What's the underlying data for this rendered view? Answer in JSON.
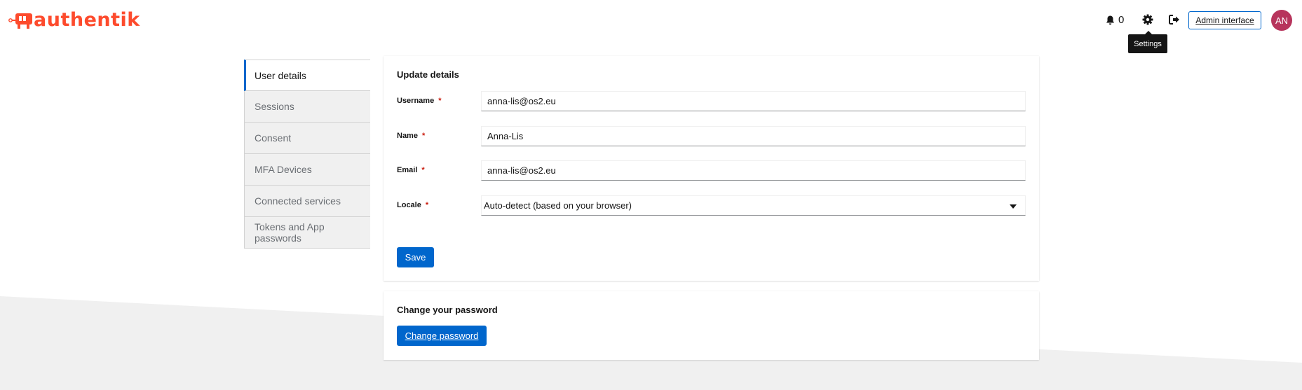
{
  "header": {
    "brand": "authentik",
    "notifications_count": "0",
    "admin_label": "Admin interface",
    "avatar_initials": "AN",
    "tooltip": "Settings"
  },
  "sidebar": {
    "items": [
      {
        "label": "User details"
      },
      {
        "label": "Sessions"
      },
      {
        "label": "Consent"
      },
      {
        "label": "MFA Devices"
      },
      {
        "label": "Connected services"
      },
      {
        "label": "Tokens and App passwords"
      }
    ]
  },
  "details": {
    "title": "Update details",
    "username_label": "Username",
    "username_value": "anna-lis@os2.eu",
    "name_label": "Name",
    "name_value": "Anna-Lis",
    "email_label": "Email",
    "email_value": "anna-lis@os2.eu",
    "locale_label": "Locale",
    "locale_value": "Auto-detect (based on your browser)",
    "required_mark": "*",
    "save_label": "Save"
  },
  "password": {
    "title": "Change your password",
    "button_label": "Change password"
  },
  "colors": {
    "brand": "#fd4b2d",
    "accent": "#0066cc",
    "required": "#c9190b"
  }
}
